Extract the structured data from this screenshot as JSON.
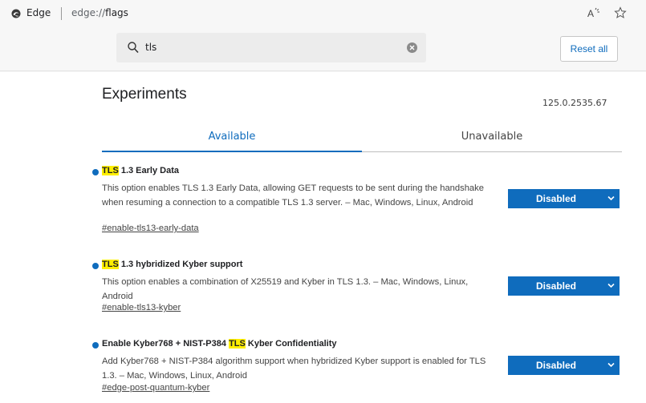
{
  "addressbar": {
    "site_name": "Edge",
    "url_scheme": "edge://",
    "url_host": "flags"
  },
  "search": {
    "query": "tls",
    "reset_label": "Reset all"
  },
  "page": {
    "title": "Experiments",
    "version": "125.0.2535.67"
  },
  "tabs": [
    {
      "label": "Available",
      "active": true
    },
    {
      "label": "Unavailable",
      "active": false
    }
  ],
  "flags": [
    {
      "title_pre": "",
      "title_hl": "TLS",
      "title_post": " 1.3 Early Data",
      "description": "This option enables TLS 1.3 Early Data, allowing GET requests to be sent during the handshake when resuming a connection to a compatible TLS 1.3 server. – Mac, Windows, Linux, Android",
      "link": "#enable-tls13-early-data",
      "value": "Disabled"
    },
    {
      "title_pre": "",
      "title_hl": "TLS",
      "title_post": " 1.3 hybridized Kyber support",
      "description": "This option enables a combination of X25519 and Kyber in TLS 1.3. – Mac, Windows, Linux, Android",
      "link": "#enable-tls13-kyber",
      "value": "Disabled"
    },
    {
      "title_pre": "Enable Kyber768 + NIST-P384 ",
      "title_hl": "TLS",
      "title_post": " Kyber Confidentiality",
      "description": "Add Kyber768 + NIST-P384 algorithm support when hybridized Kyber support is enabled for TLS 1.3. – Mac, Windows, Linux, Android",
      "link": "#edge-post-quantum-kyber",
      "value": "Disabled"
    }
  ],
  "colors": {
    "accent": "#0f6cbd",
    "highlight": "#ffef00"
  }
}
